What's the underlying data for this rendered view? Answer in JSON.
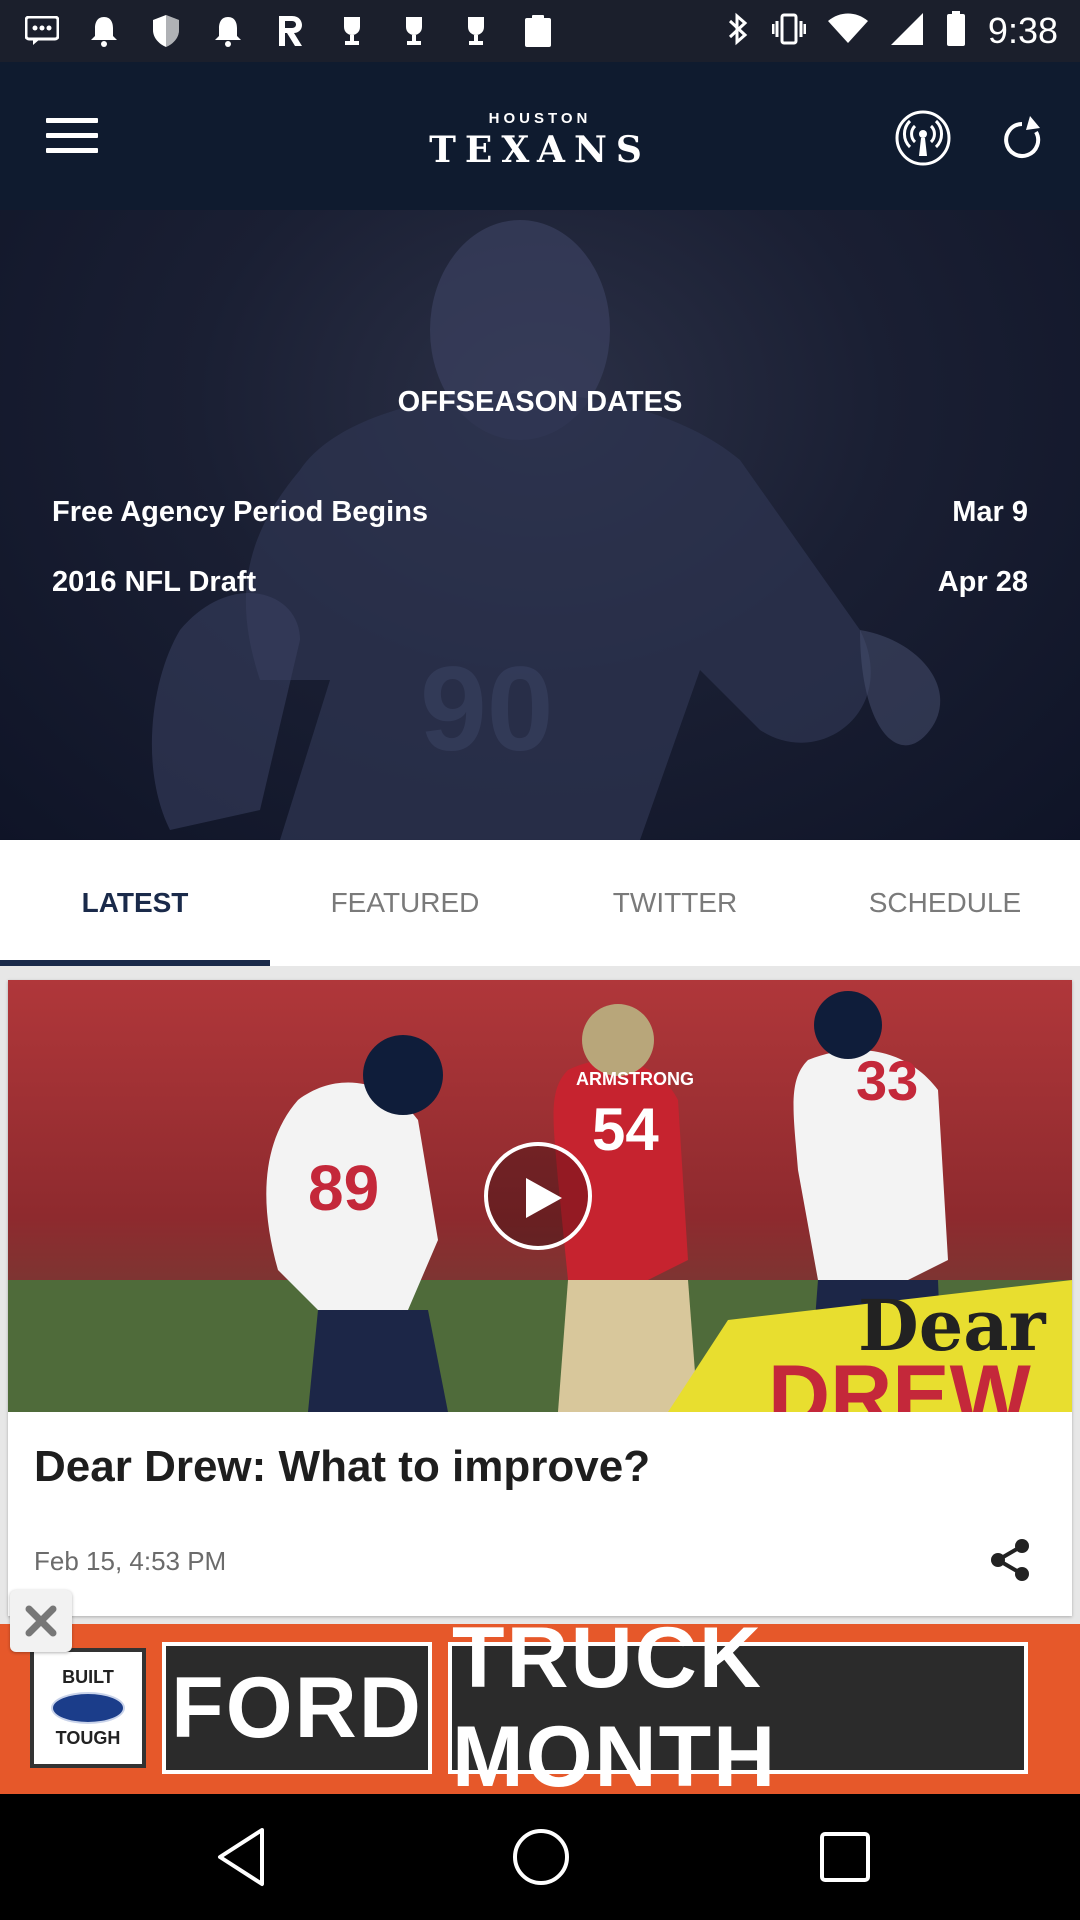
{
  "status_bar": {
    "time": "9:38",
    "icons": [
      "messages-icon",
      "bell-icon",
      "shield-icon",
      "bell-icon",
      "r-app-icon",
      "trophy-icon",
      "trophy-icon",
      "trophy-icon",
      "clipboard-icon",
      "bluetooth-icon",
      "vibrate-icon",
      "wifi-icon",
      "signal-icon",
      "battery-icon"
    ]
  },
  "app_bar": {
    "logo_top": "HOUSTON",
    "logo_main": "TEXANS"
  },
  "hero": {
    "title": "OFFSEASON DATES",
    "rows": [
      {
        "event": "Free Agency Period Begins",
        "date": "Mar 9"
      },
      {
        "event": "2016 NFL Draft",
        "date": "Apr 28"
      }
    ]
  },
  "tabs": [
    {
      "label": "LATEST",
      "active": true
    },
    {
      "label": "FEATURED",
      "active": false
    },
    {
      "label": "TWITTER",
      "active": false
    },
    {
      "label": "SCHEDULE",
      "active": false
    }
  ],
  "card": {
    "title": "Dear Drew: What to improve?",
    "date": "Feb 15, 4:53 PM",
    "thumb_overlay_top": "Dear",
    "thumb_overlay_bottom": "DREW",
    "jersey_numbers": [
      "89",
      "54",
      "33"
    ],
    "jersey_name": "ARMSTRONG"
  },
  "ad": {
    "badge_top": "BUILT",
    "badge_bottom": "TOUGH",
    "word1": "FORD",
    "word2": "TRUCK MONTH"
  },
  "colors": {
    "app_bar": "#0f1b2f",
    "tab_active": "#1a2a4a",
    "ad_bg": "#e6582a"
  }
}
